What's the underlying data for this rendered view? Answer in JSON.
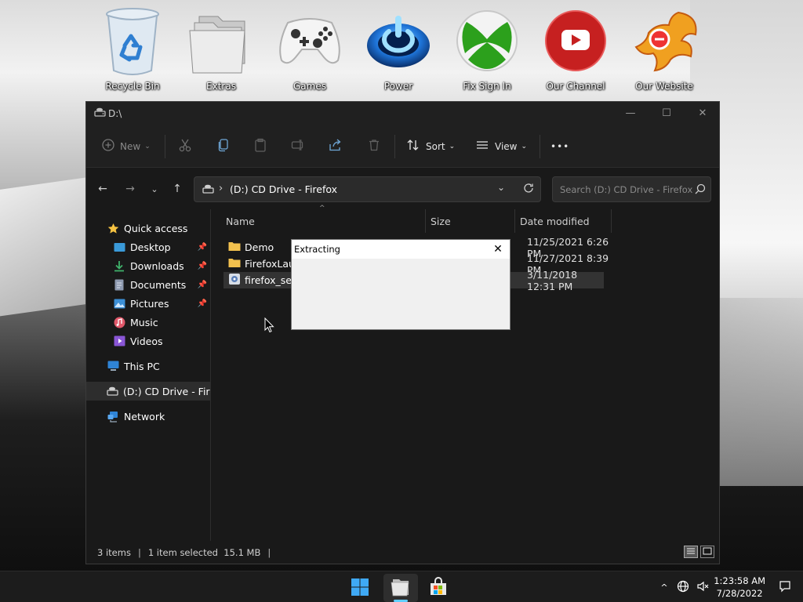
{
  "desktop": {
    "icons": [
      {
        "label": "Recycle Bin",
        "icon": "recycle-bin-icon"
      },
      {
        "label": "Extras",
        "icon": "folder-stack-icon"
      },
      {
        "label": "Games",
        "icon": "xbox-controller-icon"
      },
      {
        "label": "Power",
        "icon": "power-icon"
      },
      {
        "label": "Fix Sign In",
        "icon": "xbox-logo-icon"
      },
      {
        "label": "Our Channel",
        "icon": "youtube-icon"
      },
      {
        "label": "Our Website",
        "icon": "phoenix-logo-icon"
      }
    ]
  },
  "window": {
    "title": "D:\\",
    "toolbar": {
      "new_label": "New",
      "sort_label": "Sort",
      "view_label": "View",
      "more_label": "•••"
    },
    "address": {
      "separator": "›",
      "path": "(D:) CD Drive - Firefox"
    },
    "search": {
      "placeholder": "Search (D:) CD Drive - Firefox"
    },
    "nav": {
      "quick_access": "Quick access",
      "desktop": "Desktop",
      "downloads": "Downloads",
      "documents": "Documents",
      "pictures": "Pictures",
      "music": "Music",
      "videos": "Videos",
      "this_pc": "This PC",
      "cd_drive": "(D:) CD Drive - Firef",
      "network": "Network"
    },
    "columns": {
      "name": "Name",
      "size": "Size",
      "date": "Date modified"
    },
    "files": [
      {
        "name": "Demo",
        "date": "11/25/2021 6:26 PM",
        "type": "folder"
      },
      {
        "name": "FirefoxLaun",
        "date": "11/27/2021 8:39 PM",
        "type": "folder"
      },
      {
        "name": "firefox_setu",
        "date": "3/11/2018 12:31 PM",
        "type": "setup",
        "selected": true
      }
    ],
    "status": {
      "items": "3 items",
      "selection": "1 item selected  15.1 MB"
    }
  },
  "dialog": {
    "title": "Extracting"
  },
  "taskbar": {
    "time": "1:23:58 AM",
    "date": "7/28/2022"
  },
  "colors": {
    "accent": "#60cdff",
    "window_bg": "#191919",
    "folder": "#f2c14e"
  }
}
